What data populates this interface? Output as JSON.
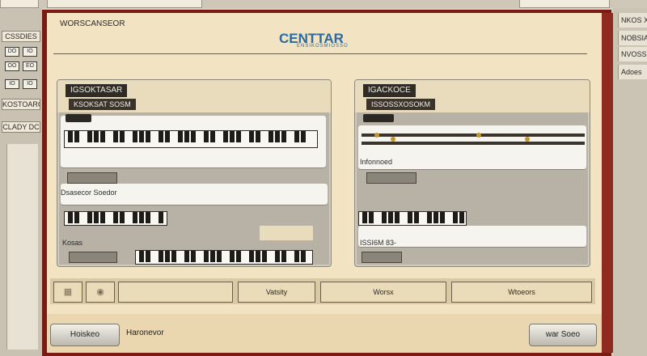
{
  "window": {
    "title": "WORSCANSEOR",
    "logo_text": "CENTTAR",
    "logo_sub": "ENSIKOSMIOSSO"
  },
  "left_panel": {
    "labels": [
      "CSSDIES",
      "KOSTOARO",
      "CLADY DC"
    ],
    "buttons": [
      "DO",
      "IO",
      "OO",
      "EO",
      "IO",
      "IO"
    ]
  },
  "right_panel": {
    "items": [
      "NKOS XMS",
      "NOBSIAN",
      "NVOSSM",
      "Adoes"
    ]
  },
  "panels": {
    "left": {
      "title": "IGSOKTASAR",
      "subtitle": "KSOKSAT SOSM",
      "mid_label": "Dsasecor Soedor",
      "bottom_label": "Kosas"
    },
    "right": {
      "title": "IGACKOCE",
      "subtitle": "ISSOSSXOSOKM",
      "mid_label": "Infonnoed",
      "bottom_label": "ISSI6M 83-"
    }
  },
  "button_row": {
    "icon1": "grid-icon",
    "icon2": "circle-icon",
    "field": "",
    "labels": [
      "Vatsity",
      "Worsx",
      "Wtoeors"
    ]
  },
  "footer": {
    "left_button": "Hoiskeo",
    "left_text": "Haronevor",
    "right_button": "war Soeo"
  }
}
